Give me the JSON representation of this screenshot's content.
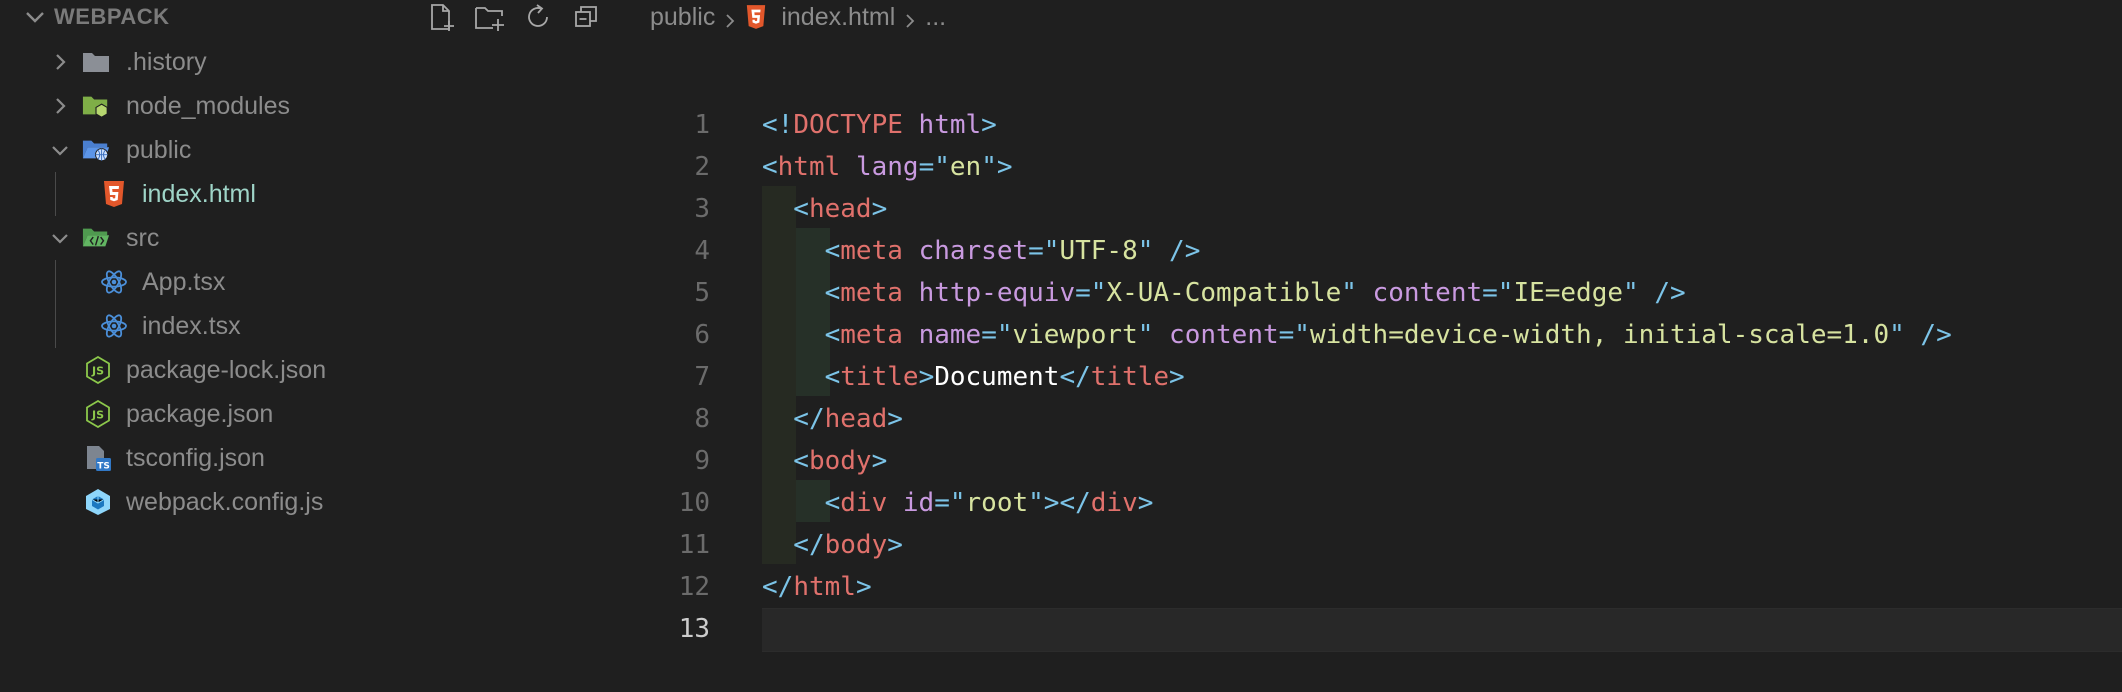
{
  "explorer": {
    "title": "WEBPACK",
    "actions": [
      "new-file-icon",
      "new-folder-icon",
      "refresh-icon",
      "collapse-all-icon"
    ],
    "items": [
      {
        "label": ".history",
        "kind": "folder",
        "expanded": false,
        "icon": "folder-icon"
      },
      {
        "label": "node_modules",
        "kind": "folder",
        "expanded": false,
        "icon": "node-folder-icon"
      },
      {
        "label": "public",
        "kind": "folder",
        "expanded": true,
        "icon": "public-folder-icon"
      },
      {
        "label": "index.html",
        "kind": "file",
        "icon": "html5-icon",
        "active": true
      },
      {
        "label": "src",
        "kind": "folder",
        "expanded": true,
        "icon": "src-folder-icon"
      },
      {
        "label": "App.tsx",
        "kind": "file",
        "icon": "react-icon"
      },
      {
        "label": "index.tsx",
        "kind": "file",
        "icon": "react-icon"
      },
      {
        "label": "package-lock.json",
        "kind": "file",
        "icon": "nodejs-icon"
      },
      {
        "label": "package.json",
        "kind": "file",
        "icon": "nodejs-icon"
      },
      {
        "label": "tsconfig.json",
        "kind": "file",
        "icon": "tsconfig-icon"
      },
      {
        "label": "webpack.config.js",
        "kind": "file",
        "icon": "webpack-icon"
      }
    ]
  },
  "breadcrumb": {
    "folder": "public",
    "file": "index.html",
    "ellipsis": "..."
  },
  "editor": {
    "line_numbers": [
      "1",
      "2",
      "3",
      "4",
      "5",
      "6",
      "7",
      "8",
      "9",
      "10",
      "11",
      "12",
      "13"
    ],
    "current_line": "13",
    "lines": [
      [
        [
          "p",
          "<!"
        ],
        [
          "d",
          "DOCTYPE"
        ],
        [
          "p",
          " "
        ],
        [
          "a",
          "html"
        ],
        [
          "p",
          ">"
        ]
      ],
      [
        [
          "p",
          "<"
        ],
        [
          "t",
          "html"
        ],
        [
          "p",
          " "
        ],
        [
          "a",
          "lang"
        ],
        [
          "p",
          "=\""
        ],
        [
          "s",
          "en"
        ],
        [
          "p",
          "\">"
        ]
      ],
      [
        [
          "p",
          "  <"
        ],
        [
          "t",
          "head"
        ],
        [
          "p",
          ">"
        ]
      ],
      [
        [
          "p",
          "    <"
        ],
        [
          "t",
          "meta"
        ],
        [
          "p",
          " "
        ],
        [
          "a",
          "charset"
        ],
        [
          "p",
          "=\""
        ],
        [
          "s",
          "UTF-8"
        ],
        [
          "p",
          "\" />"
        ]
      ],
      [
        [
          "p",
          "    <"
        ],
        [
          "t",
          "meta"
        ],
        [
          "p",
          " "
        ],
        [
          "a",
          "http-equiv"
        ],
        [
          "p",
          "=\""
        ],
        [
          "s",
          "X-UA-Compatible"
        ],
        [
          "p",
          "\" "
        ],
        [
          "a",
          "content"
        ],
        [
          "p",
          "=\""
        ],
        [
          "s",
          "IE=edge"
        ],
        [
          "p",
          "\" />"
        ]
      ],
      [
        [
          "p",
          "    <"
        ],
        [
          "t",
          "meta"
        ],
        [
          "p",
          " "
        ],
        [
          "a",
          "name"
        ],
        [
          "p",
          "=\""
        ],
        [
          "s",
          "viewport"
        ],
        [
          "p",
          "\" "
        ],
        [
          "a",
          "content"
        ],
        [
          "p",
          "=\""
        ],
        [
          "s",
          "width=device-width, initial-scale=1.0"
        ],
        [
          "p",
          "\" />"
        ]
      ],
      [
        [
          "p",
          "    <"
        ],
        [
          "t",
          "title"
        ],
        [
          "p",
          ">"
        ],
        [
          "x",
          "Document"
        ],
        [
          "p",
          "</"
        ],
        [
          "t",
          "title"
        ],
        [
          "p",
          ">"
        ]
      ],
      [
        [
          "p",
          "  </"
        ],
        [
          "t",
          "head"
        ],
        [
          "p",
          ">"
        ]
      ],
      [
        [
          "p",
          "  <"
        ],
        [
          "t",
          "body"
        ],
        [
          "p",
          ">"
        ]
      ],
      [
        [
          "p",
          "    <"
        ],
        [
          "t",
          "div"
        ],
        [
          "p",
          " "
        ],
        [
          "a",
          "id"
        ],
        [
          "p",
          "=\""
        ],
        [
          "s",
          "root"
        ],
        [
          "p",
          "\"></"
        ],
        [
          "t",
          "div"
        ],
        [
          "p",
          ">"
        ]
      ],
      [
        [
          "p",
          "  </"
        ],
        [
          "t",
          "body"
        ],
        [
          "p",
          ">"
        ]
      ],
      [
        [
          "p",
          "</"
        ],
        [
          "t",
          "html"
        ],
        [
          "p",
          ">"
        ]
      ],
      []
    ]
  }
}
